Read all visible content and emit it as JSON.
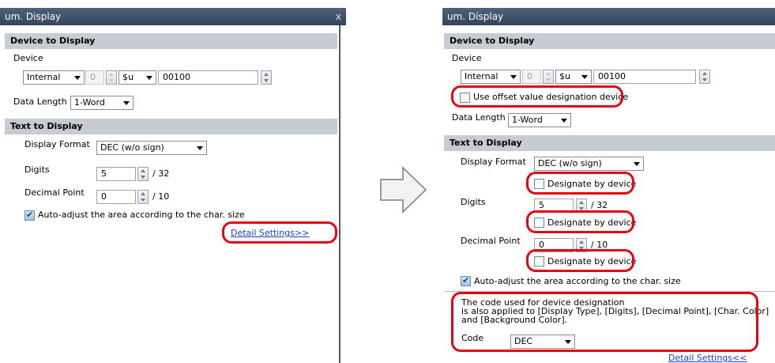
{
  "left": {
    "title": "um. Display",
    "close_label": "x",
    "device_section": "Device to Display",
    "device_label": "Device",
    "device_type": "Internal",
    "offset": "0",
    "device_code": "$u",
    "address": "00100",
    "data_length_label": "Data Length",
    "data_length": "1-Word",
    "text_section": "Text to Display",
    "display_format_label": "Display Format",
    "display_format": "DEC (w/o sign)",
    "digits_label": "Digits",
    "digits": "5",
    "digits_max": "/ 32",
    "decimal_label": "Decimal Point",
    "decimal": "0",
    "decimal_max": "/ 10",
    "auto_adjust_label": "Auto-adjust the area according to the char. size",
    "detail_link": "Detail Settings>>"
  },
  "right": {
    "title": "um. Display",
    "device_section": "Device to Display",
    "device_label": "Device",
    "device_type": "Internal",
    "offset": "0",
    "device_code": "$u",
    "address": "00100",
    "offset_device_label": "Use offset value designation device",
    "data_length_label": "Data Length",
    "data_length": "1-Word",
    "text_section": "Text to Display",
    "display_format_label": "Display Format",
    "display_format": "DEC (w/o sign)",
    "designate_label": "Designate by device",
    "digits_label": "Digits",
    "digits": "5",
    "digits_max": "/ 32",
    "decimal_label": "Decimal Point",
    "decimal": "0",
    "decimal_max": "/ 10",
    "auto_adjust_label": "Auto-adjust the area according to the char. size",
    "note_line1": "The code used for device designation",
    "note_line2": "is also applied to [Display Type], [Digits], [Decimal Point], [Char. Color]",
    "note_line3": "and [Background Color].",
    "code_label": "Code",
    "code_value": "DEC",
    "detail_link": "Detail Settings<<"
  },
  "colors": {
    "highlight": "#e30613",
    "section_bg": "#c7ccd3",
    "titlebar": "#3d4f66",
    "link": "#1a3fd6"
  }
}
